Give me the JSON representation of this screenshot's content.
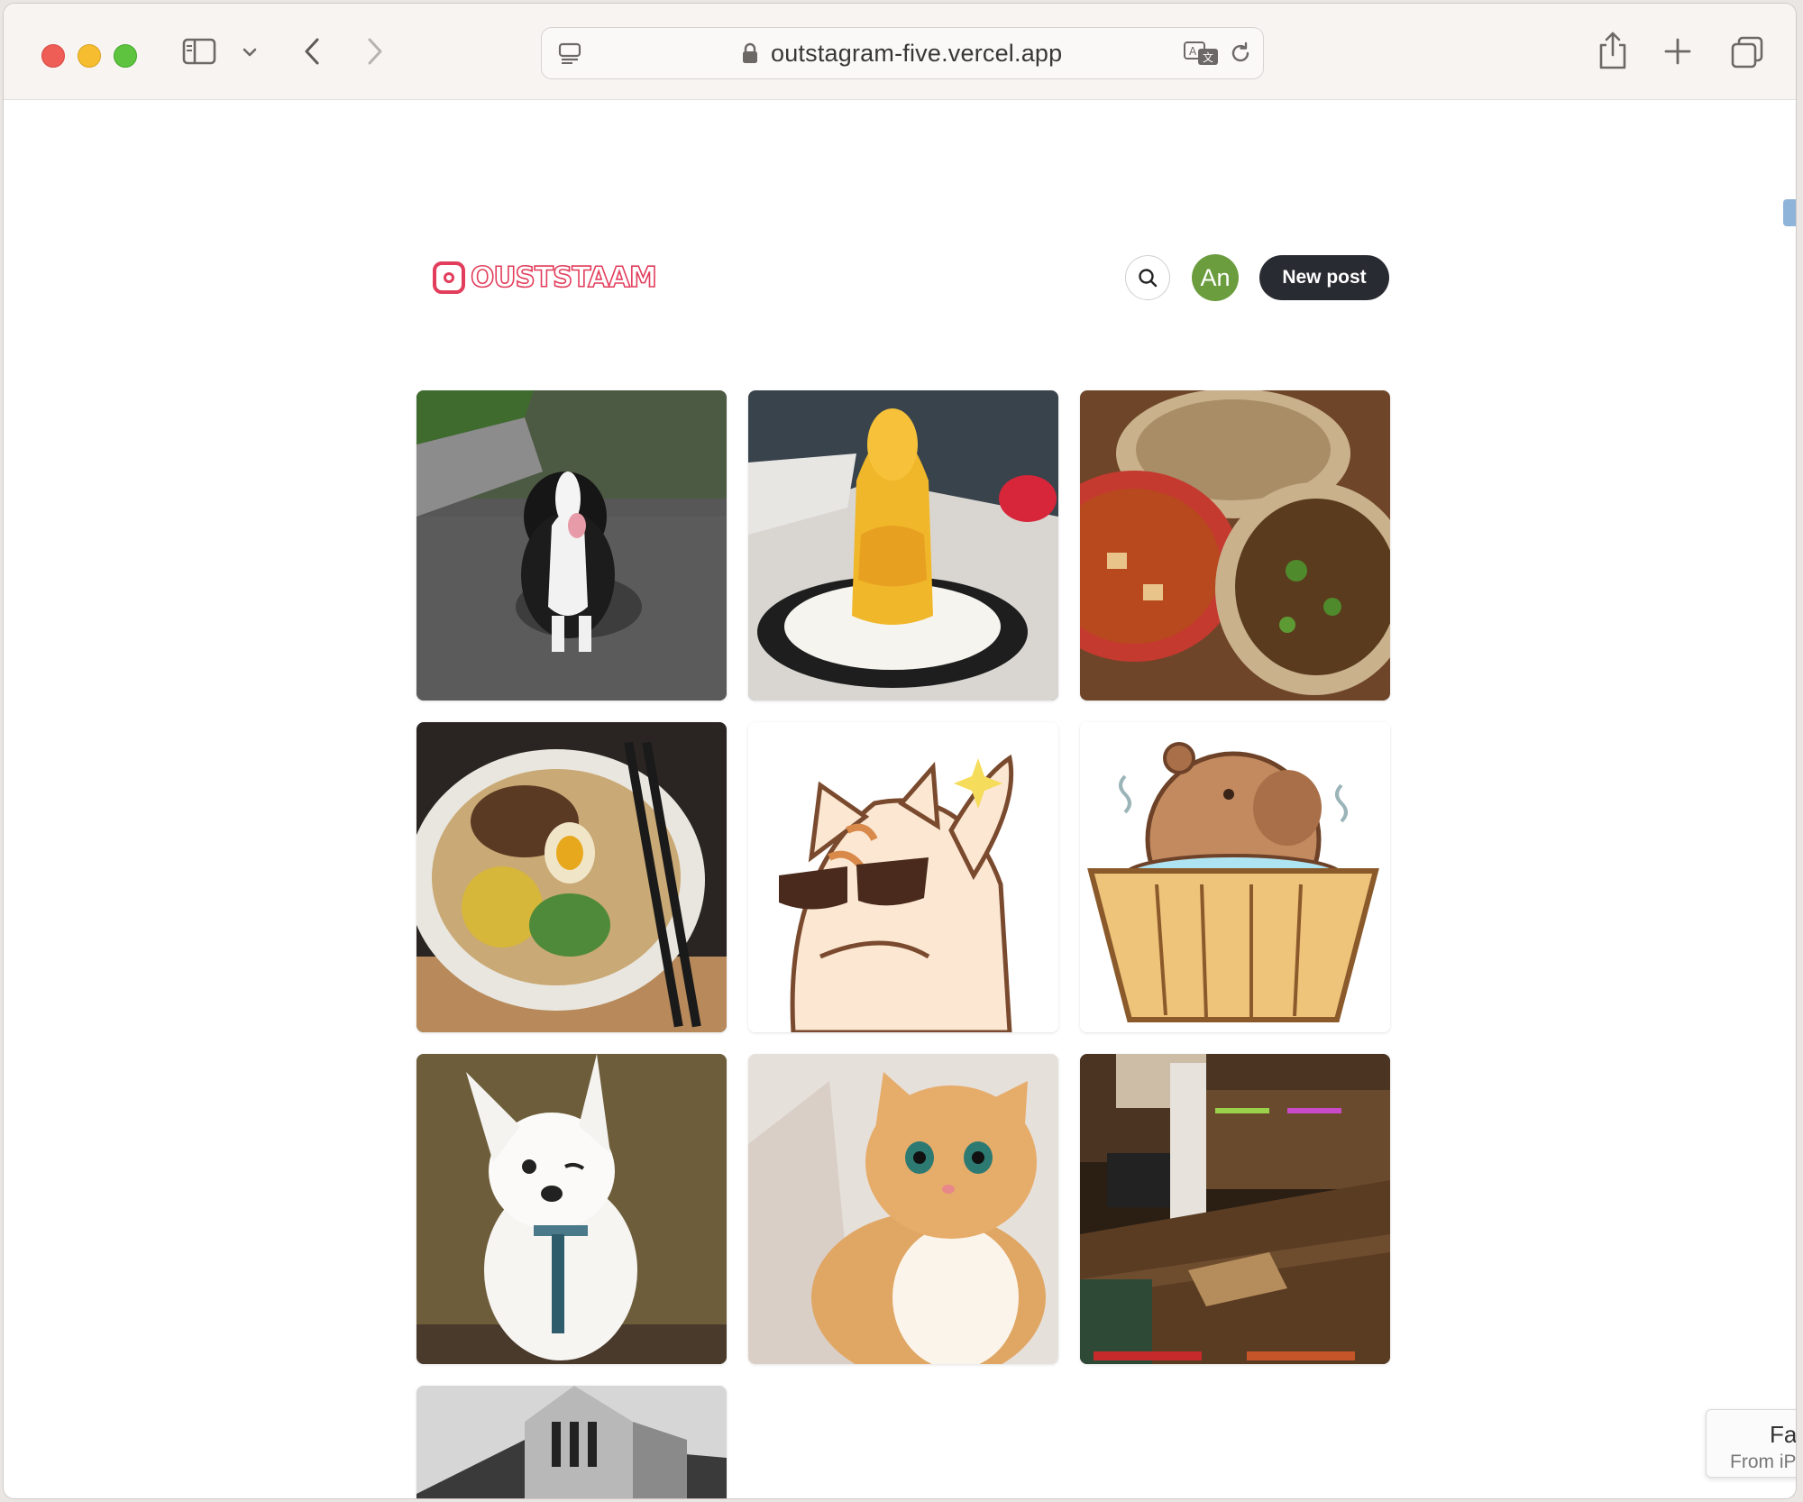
{
  "browser": {
    "url": "outstagram-five.vercel.app",
    "colors": {
      "close": "#ee5e57",
      "minimize": "#f5bd2f",
      "maximize": "#5ec43f"
    }
  },
  "header": {
    "logo_text": "OUSTSTAAM",
    "avatar_initials": "An",
    "new_post_label": "New post",
    "colors": {
      "logo": "#e23d5b",
      "avatar": "#6b9d3f",
      "new_post_bg": "#282b31"
    }
  },
  "posts": [
    {
      "subject": "border collie dog on road"
    },
    {
      "subject": "mango shaved ice dessert"
    },
    {
      "subject": "chinese dishes on table"
    },
    {
      "subject": "ramen bowl with egg and corn"
    },
    {
      "subject": "cartoon cat with sunglasses"
    },
    {
      "subject": "capybara in wooden tub"
    },
    {
      "subject": "white chihuahua winking"
    },
    {
      "subject": "ginger cat looking up"
    },
    {
      "subject": "minecraft interior screenshot"
    },
    {
      "subject": "black and white building"
    }
  ],
  "toast": {
    "title": "Fac",
    "subtitle": "From iPh"
  }
}
